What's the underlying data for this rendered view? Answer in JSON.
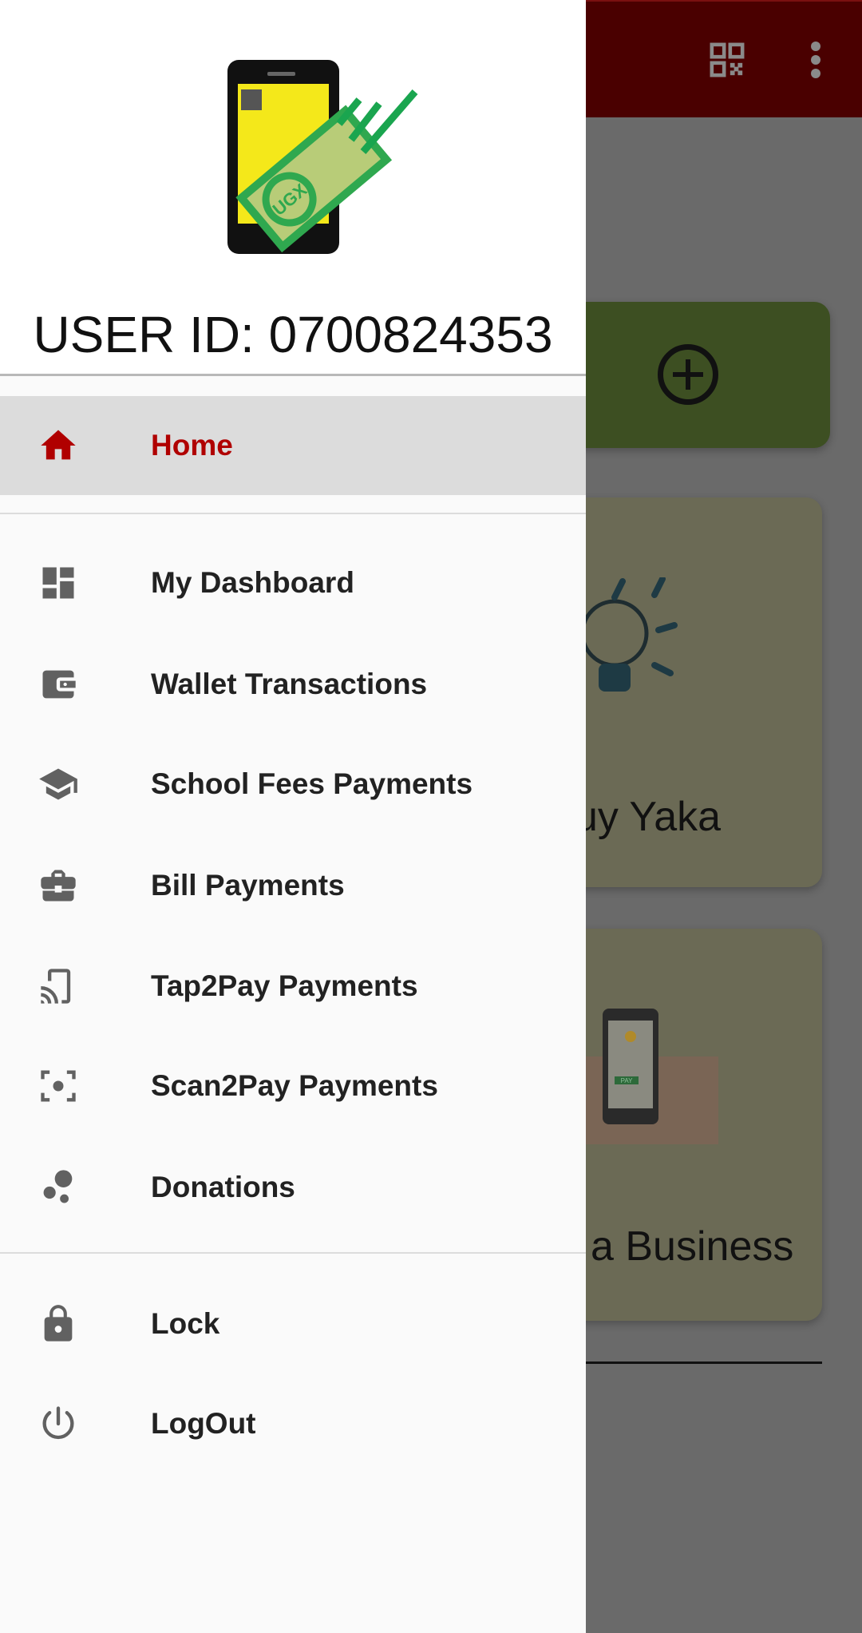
{
  "background": {
    "toolbar_icons": [
      "qr-code-icon",
      "more-vert-icon"
    ],
    "cards": [
      {
        "label": "Buy Yaka",
        "visible_text": "uy Yaka",
        "image": "light-bulb"
      },
      {
        "label": "a Business",
        "visible_text": "a Business",
        "image": "phone-pay"
      }
    ],
    "pay_image_text": "PAY"
  },
  "drawer": {
    "logo_text": "UGX",
    "user_id": "USER ID: 0700824353",
    "items": [
      {
        "label": "Home",
        "icon": "home-icon",
        "active": true
      },
      {
        "label": "My Dashboard",
        "icon": "dashboard-icon"
      },
      {
        "label": "Wallet Transactions",
        "icon": "wallet-icon"
      },
      {
        "label": "School Fees Payments",
        "icon": "school-icon"
      },
      {
        "label": "Bill Payments",
        "icon": "briefcase-icon"
      },
      {
        "label": "Tap2Pay Payments",
        "icon": "cast-icon"
      },
      {
        "label": "Scan2Pay Payments",
        "icon": "scan-icon"
      },
      {
        "label": "Donations",
        "icon": "bubbles-icon"
      },
      {
        "label": "Lock",
        "icon": "lock-icon"
      },
      {
        "label": "LogOut",
        "icon": "power-icon"
      }
    ]
  },
  "colors": {
    "accent": "#b00000",
    "toolbar": "#4a0000",
    "icon": "#616161"
  }
}
